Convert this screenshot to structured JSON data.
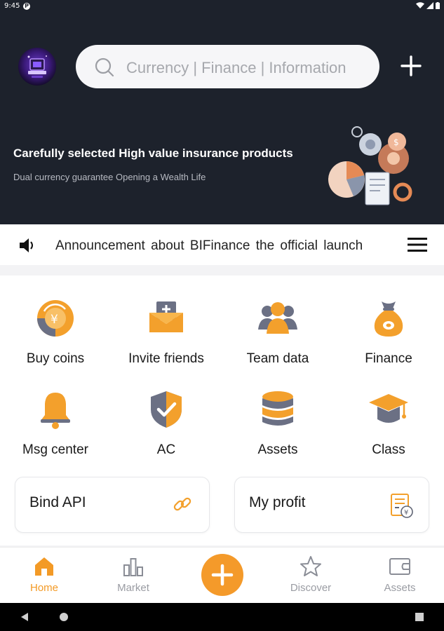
{
  "status_bar": {
    "time": "9:45",
    "badge": "P"
  },
  "search": {
    "placeholder": "Currency | Finance | Information"
  },
  "banner": {
    "title": "Carefully selected High value insurance products",
    "subtitle": "Dual currency guarantee Opening a Wealth Life"
  },
  "announcement": {
    "text": "Announcement about BIFinance the official launch"
  },
  "grid": [
    {
      "label": "Buy coins",
      "icon": "buy-coins-icon"
    },
    {
      "label": "Invite friends",
      "icon": "invite-envelope-icon"
    },
    {
      "label": "Team data",
      "icon": "team-icon"
    },
    {
      "label": "Finance",
      "icon": "money-bag-icon"
    },
    {
      "label": "Msg center",
      "icon": "bell-icon"
    },
    {
      "label": "AC",
      "icon": "shield-check-icon"
    },
    {
      "label": "Assets",
      "icon": "database-icon"
    },
    {
      "label": "Class",
      "icon": "graduation-cap-icon"
    }
  ],
  "cards": [
    {
      "label": "Bind API",
      "icon": "link-icon"
    },
    {
      "label": "My profit",
      "icon": "invoice-icon"
    }
  ],
  "tabs": [
    {
      "label": "Home",
      "icon": "home-icon",
      "active": true
    },
    {
      "label": "Market",
      "icon": "bar-chart-icon",
      "active": false
    },
    {
      "label": "Discover",
      "icon": "star-icon",
      "active": false
    },
    {
      "label": "Assets",
      "icon": "wallet-icon",
      "active": false
    }
  ],
  "colors": {
    "accent": "#f39a26",
    "header_bg": "#1d222c",
    "icon_gray": "#5f6474"
  }
}
